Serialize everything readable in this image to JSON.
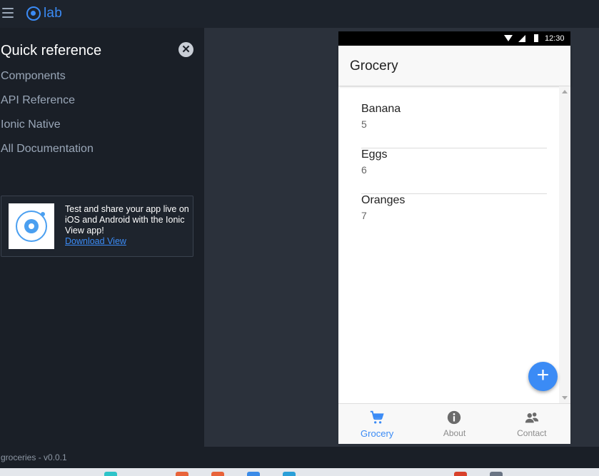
{
  "topbar": {
    "logo_text": "lab"
  },
  "sidebar": {
    "title": "Quick reference",
    "nav": [
      "Components",
      "API Reference",
      "Ionic Native",
      "All Documentation"
    ],
    "promo": {
      "text": "Test and share your app live on iOS and Android with the Ionic View app!",
      "link": "Download View"
    }
  },
  "phone": {
    "status": {
      "time": "12:30"
    },
    "title": "Grocery",
    "items": [
      {
        "name": "Banana",
        "quantity": "5"
      },
      {
        "name": "Eggs",
        "quantity": "6"
      },
      {
        "name": "Oranges",
        "quantity": "7"
      }
    ],
    "fab_label": "+",
    "tabs": [
      {
        "label": "Grocery",
        "icon": "cart-icon",
        "active": true
      },
      {
        "label": "About",
        "icon": "info-icon",
        "active": false
      },
      {
        "label": "Contact",
        "icon": "contacts-icon",
        "active": false
      }
    ]
  },
  "footer": {
    "version": "groceries - v0.0.1"
  },
  "colors": {
    "accent": "#3b8bf5",
    "sidebar_bg": "#1a1f27",
    "main_bg": "#2b313b"
  }
}
